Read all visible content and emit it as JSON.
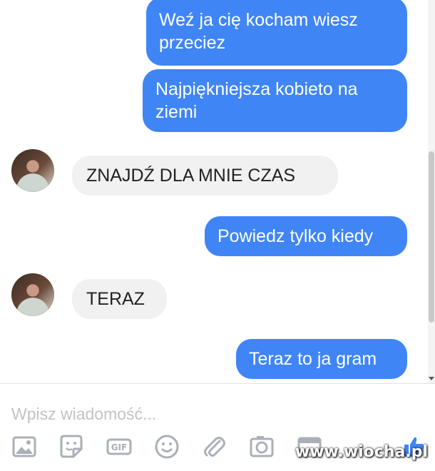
{
  "messages": [
    {
      "side": "out",
      "text": "Weź ja cię kocham wiesz przeciez"
    },
    {
      "side": "out",
      "text": "Najpiękniejsza kobieto na ziemi"
    },
    {
      "side": "in",
      "text": "ZNAJDŹ DLA MNIE CZAS"
    },
    {
      "side": "out",
      "text": "Powiedz tylko kiedy"
    },
    {
      "side": "in",
      "text": "TERAZ"
    },
    {
      "side": "out",
      "text": "Teraz to ja gram"
    }
  ],
  "composer": {
    "placeholder": "Wpisz wiadomość..."
  },
  "toolbar": {
    "icons": [
      "image-icon",
      "sticker-icon",
      "gif-icon",
      "emoji-icon",
      "attachment-icon",
      "camera-icon",
      "calendar-icon",
      "like-icon"
    ],
    "gif_label": "GIF"
  },
  "watermark": {
    "text": "www.wiocha.pl"
  },
  "colors": {
    "outgoing": "#3f85f6",
    "incoming": "#f1f1f1",
    "icon": "#aab0b7"
  }
}
